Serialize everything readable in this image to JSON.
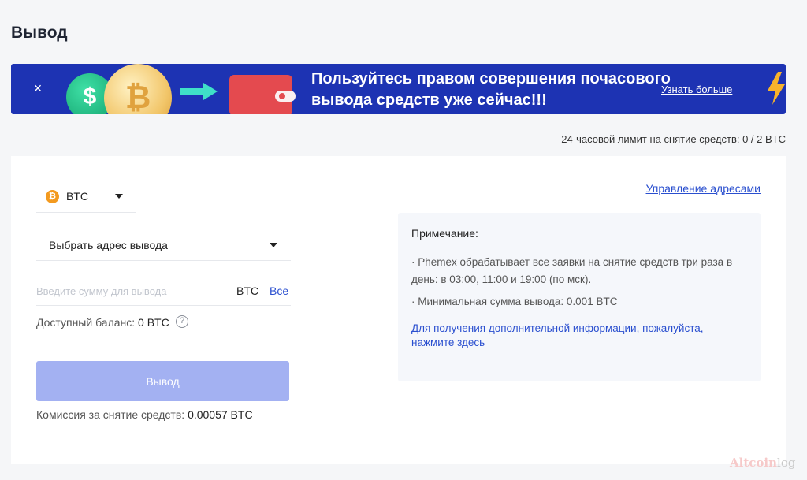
{
  "page": {
    "title": "Вывод"
  },
  "banner": {
    "text_line1": "Пользуйтесь правом совершения почасового",
    "text_line2": "вывода средств уже сейчас!!!",
    "link": "Узнать больше",
    "close_icon": "×",
    "colors": {
      "background": "#1d33b3"
    }
  },
  "limit": {
    "text": "24-часовой лимит на снятие средств: 0 / 2 BTC"
  },
  "form": {
    "coin": {
      "icon_letter": "₿",
      "value": "BTC"
    },
    "address": {
      "placeholder": "Выбрать адрес вывода"
    },
    "amount": {
      "placeholder": "Введите сумму для вывода",
      "unit": "BTC",
      "all_label": "Все"
    },
    "balance": {
      "label": "Доступный баланс:",
      "value": "0 BTC",
      "help_icon": "?"
    },
    "submit_label": "Вывод",
    "fee": {
      "label": "Комиссия за снятие средств:",
      "value": "0.00057 BTC"
    }
  },
  "manage_addresses": "Управление адресами",
  "note": {
    "title": "Примечание:",
    "line1": "· Phemex обрабатывает все заявки на снятие средств три раза в день: в 03:00, 11:00 и 19:00 (по мск).",
    "line2": "· Минимальная сумма вывода: 0.001 BTC",
    "link": "Для получения дополнительной информации, пожалуйста, нажмите здесь"
  },
  "watermark": {
    "part1": "Altcoin",
    "part2": "log"
  },
  "colors": {
    "accent": "#2a4fcf",
    "button": "#a3b1f2",
    "btc": "#f39a1f"
  }
}
